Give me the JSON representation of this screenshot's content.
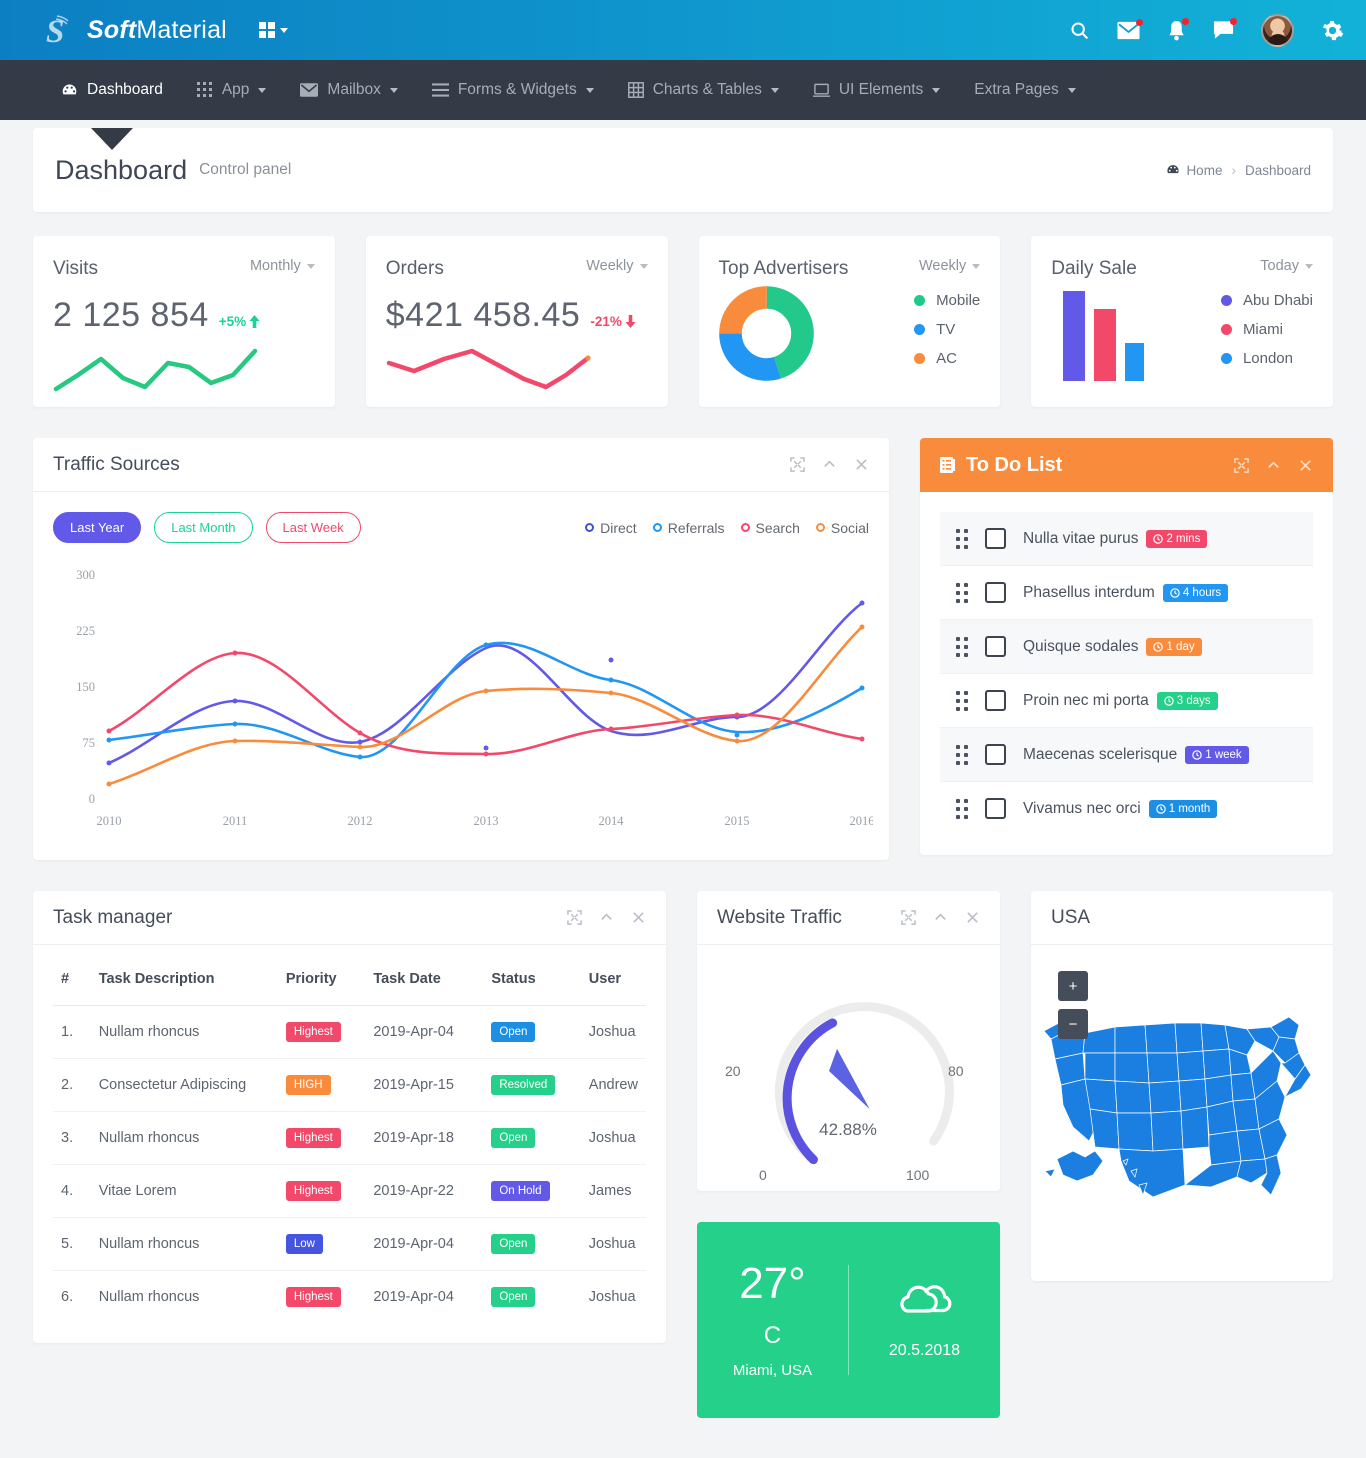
{
  "topbar": {
    "brand_bold": "Soft",
    "brand_light": "Material",
    "logo_icon": "s-logo-icon",
    "grid_toggle_icon": "grid-toggle-icon",
    "icons": [
      {
        "name": "search-icon",
        "badge": false
      },
      {
        "name": "mail-icon",
        "badge": true
      },
      {
        "name": "bell-icon",
        "badge": true
      },
      {
        "name": "chat-icon",
        "badge": true
      }
    ],
    "avatar_name": "user-avatar",
    "settings_icon": "gear-icon"
  },
  "nav": {
    "items": [
      {
        "label": "Dashboard",
        "icon": "speedometer-icon",
        "active": true,
        "caret": false
      },
      {
        "label": "App",
        "icon": "apps-grid-icon",
        "active": false,
        "caret": true
      },
      {
        "label": "Mailbox",
        "icon": "envelope-icon",
        "active": false,
        "caret": true
      },
      {
        "label": "Forms & Widgets",
        "icon": "list-icon",
        "active": false,
        "caret": true
      },
      {
        "label": "Charts & Tables",
        "icon": "table-icon",
        "active": false,
        "caret": true
      },
      {
        "label": "UI Elements",
        "icon": "laptop-icon",
        "active": false,
        "caret": true
      },
      {
        "label": "Extra Pages",
        "icon": "",
        "active": false,
        "caret": true
      }
    ]
  },
  "page_header": {
    "title": "Dashboard",
    "subtitle": "Control panel",
    "breadcrumb_home": "Home",
    "breadcrumb_home_icon": "speedometer-icon",
    "breadcrumb_sep": "›",
    "breadcrumb_current": "Dashboard"
  },
  "stats": [
    {
      "label": "Visits",
      "period": "Monthly",
      "value": "2 125 854",
      "delta": "+5%",
      "delta_dir": "up",
      "delta_color": "#19d398",
      "spark_color": "#26c97f",
      "spark_points": [
        28,
        18,
        6,
        22,
        30,
        8,
        14,
        30,
        36,
        2
      ]
    },
    {
      "label": "Orders",
      "period": "Weekly",
      "value": "$421 458.45",
      "delta": "-21%",
      "delta_dir": "down",
      "delta_color": "#f2496b",
      "spark_color": "#f2496b",
      "spark_points": [
        18,
        26,
        12,
        4,
        18,
        30,
        38,
        30,
        20,
        8
      ]
    }
  ],
  "top_advertisers": {
    "label": "Top Advertisers",
    "period": "Weekly",
    "legend": [
      {
        "label": "Mobile",
        "color": "#22c98a"
      },
      {
        "label": "TV",
        "color": "#2196f3"
      },
      {
        "label": "AC",
        "color": "#f98b3c"
      }
    ]
  },
  "daily_sale": {
    "label": "Daily Sale",
    "period": "Today",
    "legend": [
      {
        "label": "Abu Dhabi",
        "color": "#6259e8"
      },
      {
        "label": "Miami",
        "color": "#f2496b"
      },
      {
        "label": "London",
        "color": "#2196f3"
      }
    ]
  },
  "traffic": {
    "title": "Traffic Sources",
    "tools": [
      "expand-icon",
      "collapse-icon",
      "close-icon"
    ],
    "filters": [
      {
        "label": "Last Year",
        "style": "solid"
      },
      {
        "label": "Last Month",
        "style": "outline-green"
      },
      {
        "label": "Last Week",
        "style": "outline-red"
      }
    ]
  },
  "todo": {
    "title": "To Do List",
    "title_icon": "clipboard-icon",
    "tools": [
      "expand-icon",
      "collapse-icon",
      "close-icon"
    ],
    "items": [
      {
        "text": "Nulla vitae purus",
        "pill": "2 mins",
        "pill_color": "#f2496b",
        "checked": false
      },
      {
        "text": "Phasellus interdum",
        "pill": "4 hours",
        "pill_color": "#2196f3",
        "checked": false
      },
      {
        "text": "Quisque sodales",
        "pill": "1 day",
        "pill_color": "#f98b3c",
        "checked": false
      },
      {
        "text": "Proin nec mi porta",
        "pill": "3 days",
        "pill_color": "#24d08a",
        "checked": false
      },
      {
        "text": "Maecenas scelerisque",
        "pill": "1 week",
        "pill_color": "#6259e8",
        "checked": false
      },
      {
        "text": "Vivamus nec orci",
        "pill": "1 month",
        "pill_color": "#1a8fe3",
        "checked": false
      }
    ]
  },
  "task_manager": {
    "title": "Task manager",
    "tools": [
      "expand-icon",
      "collapse-icon",
      "close-icon"
    ],
    "columns": [
      "#",
      "Task Description",
      "Priority",
      "Task Date",
      "Status",
      "User"
    ],
    "rows": [
      {
        "num": "1.",
        "desc": "Nullam rhoncus",
        "priority": "Highest",
        "priority_color": "#f2496b",
        "date": "2019-Apr-04",
        "status": "Open",
        "status_color": "#1a8fe3",
        "user": "Joshua"
      },
      {
        "num": "2.",
        "desc": "Consectetur Adipiscing",
        "priority": "HIGH",
        "priority_color": "#f98b3c",
        "date": "2019-Apr-15",
        "status": "Resolved",
        "status_color": "#24d08a",
        "user": "Andrew"
      },
      {
        "num": "3.",
        "desc": "Nullam rhoncus",
        "priority": "Highest",
        "priority_color": "#f2496b",
        "date": "2019-Apr-18",
        "status": "Open",
        "status_color": "#24d08a",
        "user": "Joshua"
      },
      {
        "num": "4.",
        "desc": "Vitae Lorem",
        "priority": "Highest",
        "priority_color": "#f2496b",
        "date": "2019-Apr-22",
        "status": "On Hold",
        "status_color": "#6259e8",
        "user": "James"
      },
      {
        "num": "5.",
        "desc": "Nullam rhoncus",
        "priority": "Low",
        "priority_color": "#4555e0",
        "date": "2019-Apr-04",
        "status": "Open",
        "status_color": "#24d08a",
        "user": "Joshua"
      },
      {
        "num": "6.",
        "desc": "Nullam rhoncus",
        "priority": "Highest",
        "priority_color": "#f2496b",
        "date": "2019-Apr-04",
        "status": "Open",
        "status_color": "#24d08a",
        "user": "Joshua"
      }
    ]
  },
  "website_traffic": {
    "title": "Website Traffic",
    "tools": [
      "expand-icon",
      "collapse-icon",
      "close-icon"
    ],
    "value_label": "42.88%",
    "value": 42.88,
    "ticks": [
      "0",
      "20",
      "80",
      "100"
    ],
    "arc_color": "#5b52e0",
    "track_color": "#ececec"
  },
  "weather": {
    "temp": "27°",
    "unit": "C",
    "city": "Miami, USA",
    "date": "20.5.2018",
    "icon": "cloud-icon",
    "bg": "#24d08a"
  },
  "usa_map": {
    "title": "USA",
    "zoom_in": "+",
    "zoom_out": "−",
    "map_color": "#1a7fe0"
  },
  "chart_data": [
    {
      "type": "line",
      "title": "Traffic Sources",
      "x": [
        "2010",
        "2011",
        "2012",
        "2013",
        "2014",
        "2015",
        "2016"
      ],
      "ylim": [
        0,
        300
      ],
      "yticks": [
        0,
        75,
        150,
        225,
        300
      ],
      "grid": false,
      "legend_position": "top-right",
      "series": [
        {
          "name": "Direct",
          "color": "#6259e8",
          "values": [
            48,
            131,
            78,
            68,
            186,
            110,
            262
          ]
        },
        {
          "name": "Referrals",
          "color": "#2196f3",
          "values": [
            79,
            100,
            57,
            207,
            160,
            103,
            148
          ]
        },
        {
          "name": "Search",
          "color": "#f2496b",
          "values": [
            91,
            196,
            88,
            60,
            93,
            113,
            80
          ]
        },
        {
          "name": "Social",
          "color": "#f98b3c",
          "values": [
            20,
            78,
            70,
            139,
            143,
            90,
            230
          ]
        }
      ]
    },
    {
      "type": "line",
      "title": "Visits sparkline",
      "values": [
        10,
        32,
        20,
        10,
        34,
        26,
        8,
        18,
        30,
        52
      ],
      "color": "#26c97f"
    },
    {
      "type": "line",
      "title": "Orders sparkline",
      "values": [
        34,
        26,
        40,
        44,
        32,
        18,
        8,
        14,
        26,
        40
      ],
      "color": "#f2496b"
    },
    {
      "type": "pie",
      "title": "Top Advertisers",
      "labels": [
        "Mobile",
        "TV",
        "AC"
      ],
      "values": [
        45,
        30,
        25
      ],
      "colors": [
        "#22c98a",
        "#2196f3",
        "#f98b3c"
      ],
      "donut": true
    },
    {
      "type": "bar",
      "title": "Daily Sale",
      "categories": [
        "Abu Dhabi",
        "Miami",
        "London"
      ],
      "values": [
        100,
        80,
        42
      ],
      "colors": [
        "#6259e8",
        "#f2496b",
        "#2196f3"
      ],
      "ylim": [
        0,
        110
      ]
    },
    {
      "type": "gauge",
      "title": "Website Traffic",
      "value": 42.88,
      "min": 0,
      "max": 100,
      "ticks": [
        0,
        20,
        80,
        100
      ],
      "label": "42.88%",
      "color": "#5b52e0"
    }
  ]
}
